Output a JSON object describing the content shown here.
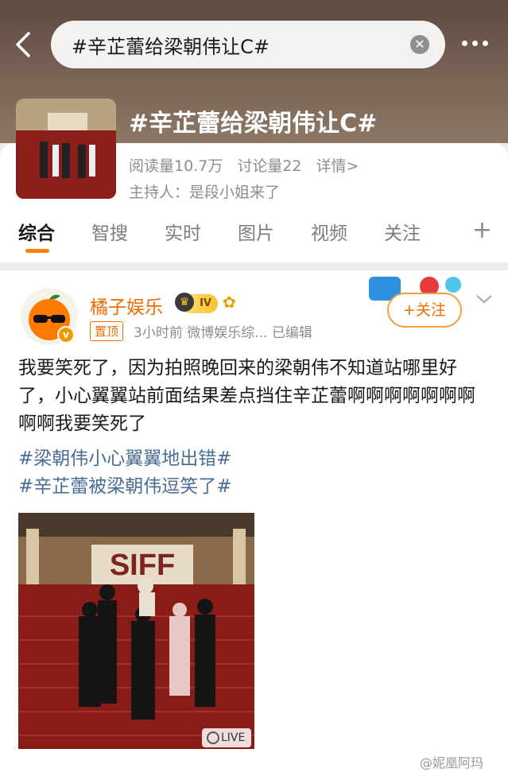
{
  "search": {
    "query": "#辛芷蕾给梁朝伟让C#"
  },
  "topic": {
    "title": "#辛芷蕾给梁朝伟让C#",
    "reads": "阅读量10.7万",
    "discussions": "讨论量22",
    "details": "详情>",
    "host": "主持人：是段小姐来了"
  },
  "tabs": [
    "综合",
    "智搜",
    "实时",
    "图片",
    "视频",
    "关注"
  ],
  "post": {
    "username": "橘子娱乐",
    "vip_level": "IV",
    "pinned": "置顶",
    "meta": "3小时前   微博娱乐综...  已编辑",
    "follow": "+关注",
    "text": "我要笑死了，因为拍照晚回来的梁朝伟不知道站哪里好了，小心翼翼站前面结果差点挡住辛芷蕾啊啊啊啊啊啊啊啊啊我要笑死了",
    "hashtags": [
      "#梁朝伟小心翼翼地出错#",
      "#辛芷蕾被梁朝伟逗笑了#"
    ],
    "photo_sign": "SIFF",
    "live": "LIVE"
  },
  "watermark": "@妮凰阿玛",
  "colors": {
    "accent": "#ff8200",
    "link": "#4a6d96",
    "username": "#f06c00"
  }
}
